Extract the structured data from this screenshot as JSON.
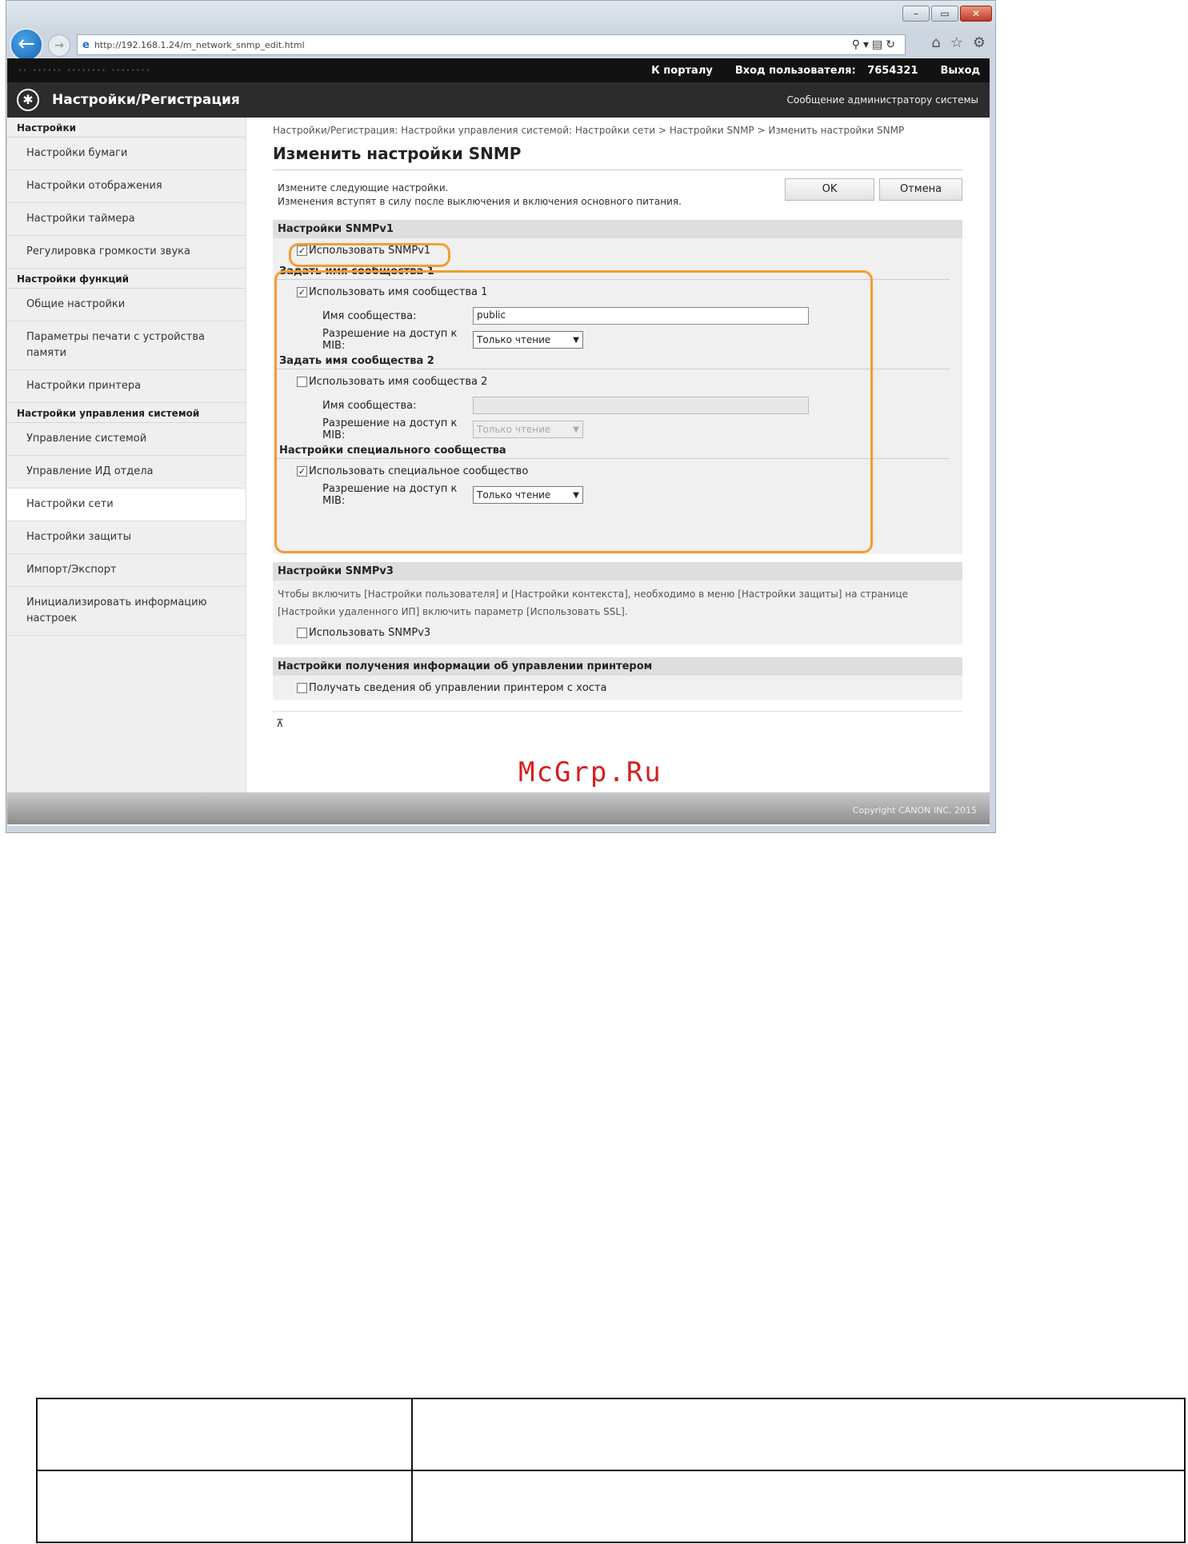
{
  "browser": {
    "url": "http://192.168.1.24/m_network_snmp_edit.html",
    "window_controls": [
      "–",
      "▭",
      "✕"
    ]
  },
  "topbar": {
    "blurred_text": "·· ······   ········ ········",
    "portal_link": "К порталу",
    "login_label": "Вход пользователя:",
    "user_id": "7654321",
    "logout": "Выход"
  },
  "header": {
    "title": "Настройки/Регистрация",
    "admin_message": "Сообщение администратору системы"
  },
  "sidebar": {
    "group1": "Настройки",
    "g1_items": [
      "Настройки бумаги",
      "Настройки отображения",
      "Настройки таймера",
      "Регулировка громкости звука"
    ],
    "group2": "Настройки функций",
    "g2_items": [
      "Общие настройки",
      "Параметры печати с устройства памяти",
      "Настройки принтера"
    ],
    "group3": "Настройки управления системой",
    "g3_items": [
      "Управление системой",
      "Управление ИД отдела",
      "Настройки сети",
      "Настройки защиты",
      "Импорт/Экспорт",
      "Инициализировать информацию настроек"
    ]
  },
  "main": {
    "breadcrumb": "Настройки/Регистрация: Настройки управления системой: Настройки сети > Настройки SNMP > Изменить настройки SNMP",
    "title": "Изменить настройки SNMP",
    "intro1": "Измените следующие настройки.",
    "intro2": "Изменения вступят в силу после выключения и включения основного питания.",
    "ok": "OK",
    "cancel": "Отмена",
    "snmpv1": {
      "head": "Настройки SNMPv1",
      "use": "Использовать SNMPv1",
      "c1_head": "Задать имя сообщества 1",
      "c1_use": "Использовать имя сообщества 1",
      "c1_name_label": "Имя сообщества:",
      "c1_name_value": "public",
      "c1_mib_label": "Разрешение на доступ к MIB:",
      "c1_mib_value": "Только чтение",
      "c2_head": "Задать имя сообщества 2",
      "c2_use": "Использовать имя сообщества 2",
      "c2_name_label": "Имя сообщества:",
      "c2_mib_label": "Разрешение на доступ к MIB:",
      "c2_mib_value": "Только чтение",
      "sp_head": "Настройки специального сообщества",
      "sp_use": "Использовать специальное сообщество",
      "sp_mib_label": "Разрешение на доступ к MIB:",
      "sp_mib_value": "Только чтение"
    },
    "snmpv3": {
      "head": "Настройки SNMPv3",
      "note": "Чтобы включить [Настройки пользователя] и [Настройки контекста], необходимо в меню [Настройки защиты] на странице [Настройки удаленного ИП] включить параметр [Использовать SSL].",
      "use": "Использовать SNMPv3"
    },
    "printer_info": {
      "head": "Настройки получения информации об управлении принтером",
      "use": "Получать сведения об управлении принтером с хоста"
    },
    "to_top": "⊼"
  },
  "footer": {
    "copyright": "Copyright CANON INC. 2015"
  },
  "watermark": "McGrp.Ru",
  "checkmarks": {
    "on": "✓",
    "off": ""
  }
}
